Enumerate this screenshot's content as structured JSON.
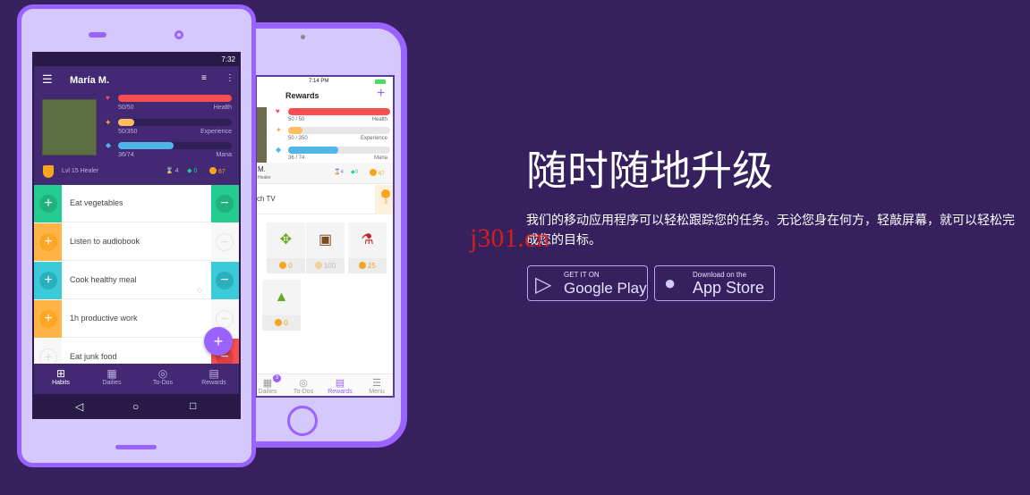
{
  "hero": {
    "title": "随时随地升级",
    "description": "我们的移动应用程序可以轻松跟踪您的任务。无论您身在何方，轻敲屏幕，就可以轻松完成您的目标。",
    "google": {
      "small": "GET IT ON",
      "big": "Google Play"
    },
    "apple": {
      "small": "Download on the",
      "big": "App Store"
    }
  },
  "watermark": "j301.cn",
  "android": {
    "time": "7:32",
    "user": "María M.",
    "health": {
      "value": "50/50",
      "label": "Health",
      "pct": 100
    },
    "exp": {
      "value": "50/350",
      "label": "Experience",
      "pct": 14
    },
    "mana": {
      "value": "36/74",
      "label": "Mana",
      "pct": 49
    },
    "level": "Lvl 15 Healer",
    "hourglass": "4",
    "gems": "0",
    "gold": "67",
    "habits": [
      "Eat vegetables",
      "Listen to audiobook",
      "Cook healthy meal",
      "1h productive work",
      "Eat junk food"
    ],
    "nav": [
      "Habits",
      "Dailies",
      "To-Dos",
      "Rewards"
    ],
    "fab": "+"
  },
  "ios": {
    "time": "7:14 PM",
    "title": "Rewards",
    "add": "+",
    "health": {
      "value": "50 / 50",
      "label": "Health",
      "pct": 100
    },
    "exp": {
      "value": "50 / 350",
      "label": "Experience",
      "pct": 14
    },
    "mana": {
      "value": "36 / 74",
      "label": "Mana",
      "pct": 49
    },
    "name": "M.",
    "level": "Healer",
    "hourglass": "4",
    "gems": "0",
    "gold": "67",
    "reward": "ch TV",
    "reward_cost": "3",
    "items": [
      {
        "icon": "✥",
        "price": "0"
      },
      {
        "icon": "▣",
        "price": "100"
      },
      {
        "icon": "⚗",
        "price": "25"
      },
      {
        "icon": "▲",
        "price": "0"
      }
    ],
    "nav": [
      "Dailies",
      "To-Dos",
      "Rewards",
      "Menu"
    ],
    "dailies_badge": "3"
  },
  "colors": {
    "bg": "#36205e",
    "accent": "#9a62ff",
    "health": "#f74e52",
    "exp": "#ffbe5d",
    "mana": "#50b5e9",
    "green": "#24cc8f",
    "orange": "#ffb445",
    "teal": "#3bcad7",
    "red": "#f74e52"
  }
}
